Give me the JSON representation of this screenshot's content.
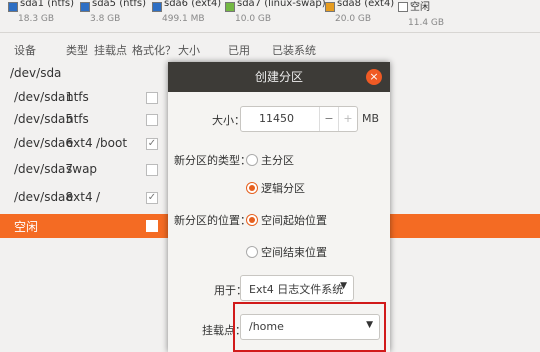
{
  "legend": [
    {
      "name": "sda1 (ntfs)",
      "size": "18.3 GB",
      "color": "#2e6fc4"
    },
    {
      "name": "sda5 (ntfs)",
      "size": "3.8 GB",
      "color": "#2e6fc4"
    },
    {
      "name": "sda6 (ext4)",
      "size": "499.1 MB",
      "color": "#2e6fc4"
    },
    {
      "name": "sda7 (linux-swap)",
      "size": "10.0 GB",
      "color": "#74b843"
    },
    {
      "name": "sda8 (ext4)",
      "size": "20.0 GB",
      "color": "#e69c20"
    },
    {
      "name": "空闲",
      "size": "11.4 GB",
      "color": "#ffffff"
    }
  ],
  "table": {
    "headers": [
      "设备",
      "类型",
      "挂载点",
      "格式化？",
      "大小",
      "已用",
      "已装系统"
    ],
    "rows": [
      {
        "device": "/dev/sda",
        "type": "",
        "mount": "",
        "format": ""
      },
      {
        "device": "/dev/sda1",
        "type": "ntfs",
        "mount": "",
        "format": ""
      },
      {
        "device": "/dev/sda5",
        "type": "ntfs",
        "mount": "",
        "format": ""
      },
      {
        "device": "/dev/sda6",
        "type": "ext4",
        "mount": "/boot",
        "format": "✓"
      },
      {
        "device": "/dev/sda7",
        "type": "swap",
        "mount": "",
        "format": ""
      },
      {
        "device": "/dev/sda8",
        "type": "ext4",
        "mount": "/",
        "format": "✓"
      },
      {
        "device": "空闲",
        "type": "",
        "mount": "",
        "format": ""
      }
    ]
  },
  "dialog": {
    "title": "创建分区",
    "close_icon": "×",
    "size_label": "大小：",
    "size_value": "11450",
    "minus": "−",
    "plus": "+",
    "unit": "MB",
    "type_label": "新分区的类型：",
    "type_options": [
      "主分区",
      "逻辑分区"
    ],
    "location_label": "新分区的位置：",
    "location_options": [
      "空间起始位置",
      "空间结束位置"
    ],
    "use_label": "用于：",
    "use_value": "Ext4 日志文件系统",
    "mount_label": "挂载点：",
    "mount_value": "/home",
    "dropdown_arrow": "▼"
  }
}
